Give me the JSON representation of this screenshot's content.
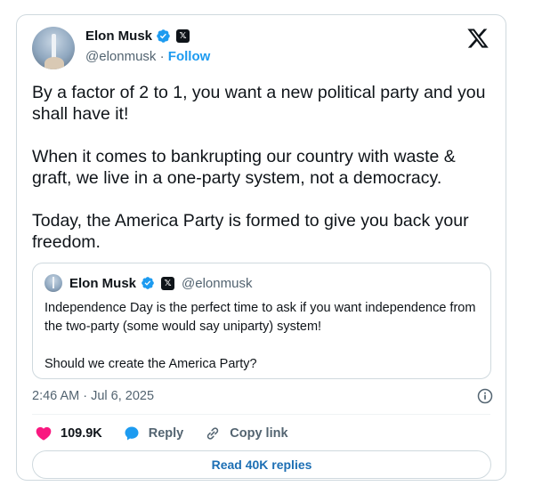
{
  "tweet": {
    "author": {
      "name": "Elon Musk",
      "handle": "@elonmusk",
      "separator": "·",
      "follow_label": "Follow"
    },
    "text": "By a factor of 2 to 1, you want a new political party and you shall have it!\n\nWhen it comes to bankrupting our country with waste & graft, we live in a one-party system, not a democracy.\n\nToday, the America Party is formed to give you back your freedom.",
    "timestamp": "2:46 AM · Jul 6, 2025"
  },
  "quoted": {
    "author": {
      "name": "Elon Musk",
      "handle": "@elonmusk"
    },
    "text": "Independence Day is the perfect time to ask if you want independence from the two-party (some would say uniparty) system!\n\nShould we create the America Party?"
  },
  "actions": {
    "likes": "109.9K",
    "reply_label": "Reply",
    "copy_link_label": "Copy link"
  },
  "read_replies_label": "Read 40K replies",
  "colors": {
    "accent": "#1d9bf0",
    "like": "#f91880",
    "verified": "#1d9bf0",
    "text": "#0f1419",
    "muted": "#536471"
  },
  "icons": [
    "x-logo-icon",
    "verified-badge-icon",
    "x-affiliate-badge-icon",
    "info-icon",
    "heart-icon",
    "reply-icon",
    "link-icon"
  ]
}
